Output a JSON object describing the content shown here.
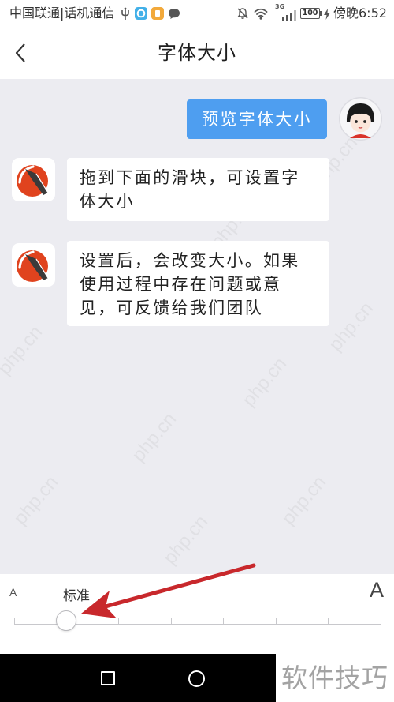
{
  "status_bar": {
    "carrier": "中国联通|话机通信",
    "left_icons": [
      "usb-icon",
      "notification-app-blue-icon",
      "notification-app-orange-icon",
      "message-icon"
    ],
    "right_icons": [
      "mute-icon",
      "wifi-icon",
      "signal-icon",
      "battery-icon",
      "charging-icon"
    ],
    "network_type": "3G",
    "battery": "100",
    "time": "傍晚6:52"
  },
  "header": {
    "back_icon": "chevron-left-icon",
    "title": "字体大小"
  },
  "chat": {
    "sent": [
      {
        "avatar": "user-avatar-icon",
        "lines": [
          "预览字体大小"
        ]
      }
    ],
    "received": [
      {
        "avatar": "app-logo-icon",
        "lines": [
          "拖到下面的滑块，可设置字",
          "体大小"
        ]
      },
      {
        "avatar": "app-logo-icon",
        "lines": [
          "设置后，会改变大小。如果",
          "使用过程中存在问题或意",
          "见，可反馈给我们团队"
        ]
      }
    ]
  },
  "font_slider": {
    "small_label": "A",
    "current_label": "标准",
    "large_label": "A",
    "steps": 8,
    "selected_index": 1
  },
  "nav_bar": {
    "icons": [
      "recent-apps-icon",
      "home-icon"
    ]
  },
  "watermarks": {
    "site": "php.cn",
    "overlay_text": "软件技巧"
  },
  "colors": {
    "accent_blue": "#4e9ef0",
    "chat_background": "#ececf1",
    "annotation_red": "#c8282c",
    "text_primary": "#222222"
  }
}
